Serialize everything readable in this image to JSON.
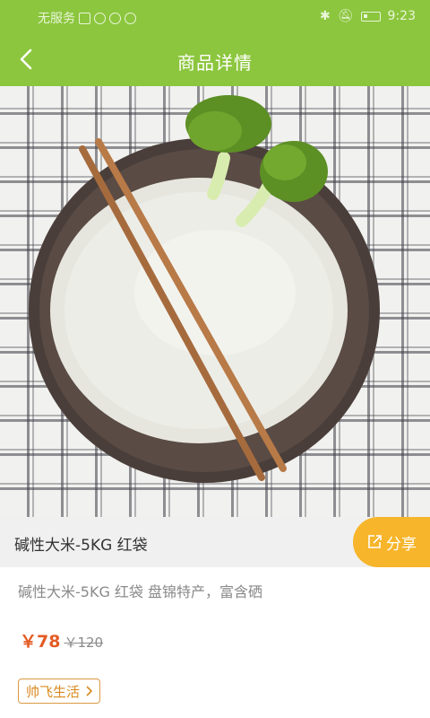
{
  "status_bar": {
    "carrier": "无服务",
    "time": "9:23"
  },
  "header": {
    "title": "商品详情",
    "back_icon": "chevron-left-icon"
  },
  "gallery": {
    "image_count": 5,
    "active_index": 1
  },
  "product": {
    "title": "碱性大米-5KG 红袋",
    "description": "碱性大米-5KG 红袋 盘锦特产，富含硒",
    "price": "￥78",
    "original_price": "￥120",
    "shop_name": "帅飞生活"
  },
  "actions": {
    "share_label": "分享",
    "share_icon": "share-icon"
  },
  "colors": {
    "header_bg": "#8cc63e",
    "share_bg": "#f7b52b",
    "price": "#e45b24",
    "shop_tag": "#d98a1f"
  }
}
